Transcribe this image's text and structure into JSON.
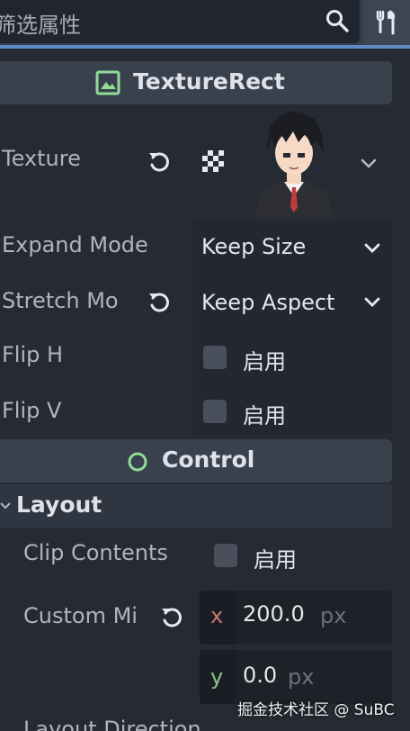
{
  "filter": {
    "placeholder": "筛选属性"
  },
  "texture_rect": {
    "section_title": "TextureRect",
    "texture_label": "Texture",
    "expand_mode_label": "Expand Mode",
    "expand_mode_value": "Keep Size",
    "stretch_mode_label": "Stretch Mo",
    "stretch_mode_value": "Keep Aspect",
    "flip_h_label": "Flip H",
    "flip_h_checkbox": "启用",
    "flip_v_label": "Flip V",
    "flip_v_checkbox": "启用"
  },
  "control": {
    "section_title": "Control",
    "layout_title": "Layout",
    "clip_contents_label": "Clip Contents",
    "clip_contents_checkbox": "启用",
    "custom_min_label": "Custom Mi",
    "custom_min_x_axis": "x",
    "custom_min_x_value": "200.0",
    "custom_min_x_unit": "px",
    "custom_min_y_axis": "y",
    "custom_min_y_value": "0.0",
    "custom_min_y_unit": "px",
    "partial_label": "Layout Direction"
  },
  "watermark": "掘金技术社区 @ SuBC",
  "colors": {
    "accent": "#5f8ac6",
    "texture_icon": "#8fdc96",
    "control_icon": "#8fdc96",
    "axis_x": "#c27a73",
    "axis_y": "#88c38a"
  }
}
